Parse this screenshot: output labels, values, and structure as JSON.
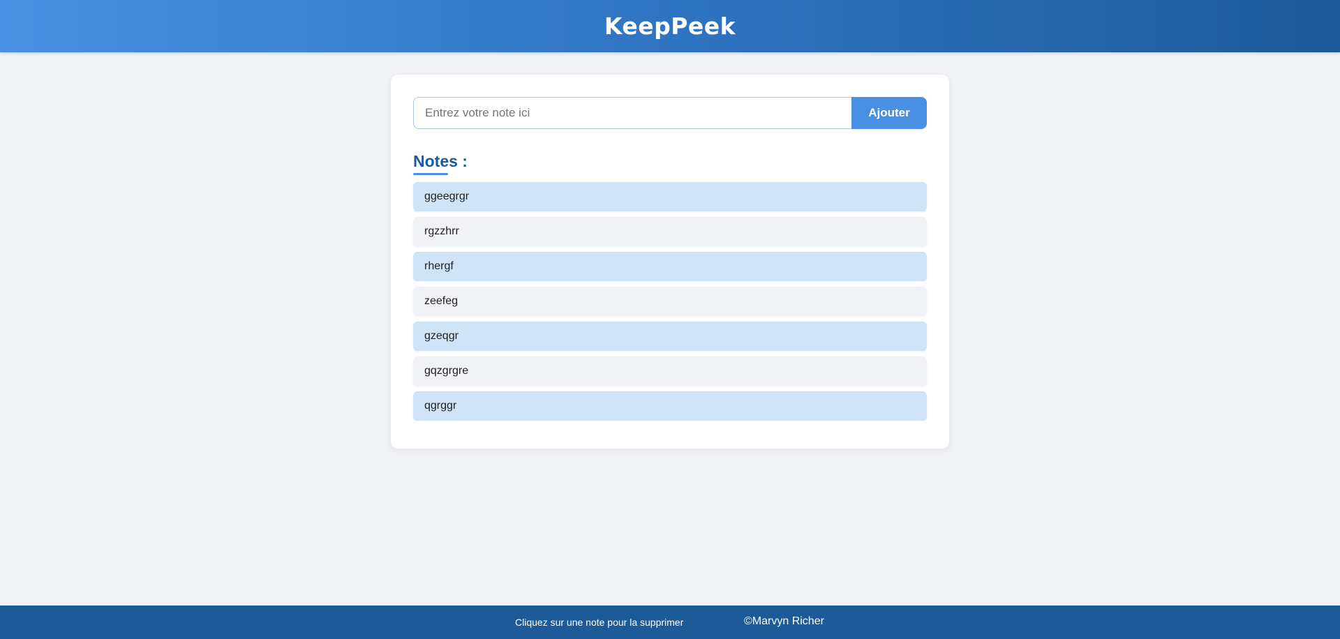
{
  "header": {
    "title": "KeepPeek",
    "background_start": "#4a90e2",
    "background_end": "#1c5a98"
  },
  "form": {
    "input_value": "",
    "input_placeholder": "Entrez votre note ici",
    "add_label": "Ajouter",
    "accent": "#4a90e2"
  },
  "notes": {
    "heading": "Notes :",
    "items": [
      {
        "text": "ggeegrgr"
      },
      {
        "text": "rgzzhrr"
      },
      {
        "text": "rhergf"
      },
      {
        "text": "zeefeg"
      },
      {
        "text": "gzeqgr"
      },
      {
        "text": "gqzgrgre"
      },
      {
        "text": "qgrggr"
      }
    ],
    "odd_color": "#d0e4f8",
    "even_color": "#f0f2f5"
  },
  "footer": {
    "hint": "Cliquez sur une note pour la supprimer",
    "copyright": "©Marvyn Richer",
    "background": "#1c5a98"
  }
}
